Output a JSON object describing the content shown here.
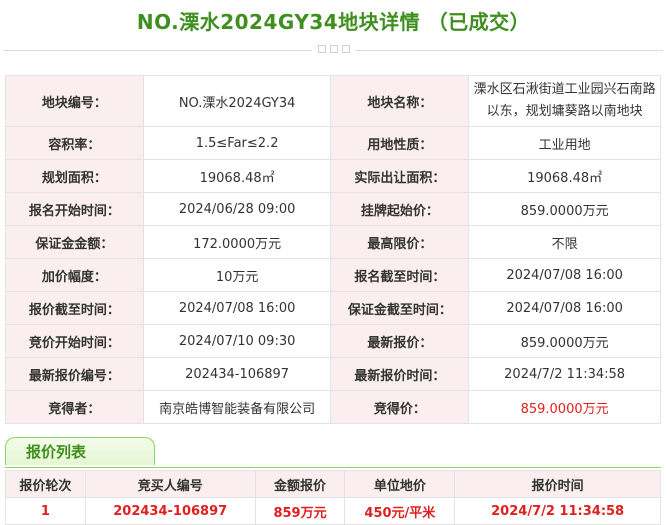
{
  "page": {
    "title": "NO.溧水2024GY34地块详情 （已成交）"
  },
  "info_rows": [
    [
      {
        "label": "地块编号：",
        "value": "NO.溧水2024GY34"
      },
      {
        "label": "地块名称：",
        "value": "溧水区石湫街道工业园兴石南路以东，规划墉葵路以南地块"
      }
    ],
    [
      {
        "label": "容积率：",
        "value": "1.5≤Far≤2.2"
      },
      {
        "label": "用地性质：",
        "value": "工业用地"
      }
    ],
    [
      {
        "label": "规划面积：",
        "value": "19068.48㎡"
      },
      {
        "label": "实际出让面积：",
        "value": "19068.48㎡"
      }
    ],
    [
      {
        "label": "报名开始时间：",
        "value": "2024/06/28 09:00"
      },
      {
        "label": "挂牌起始价：",
        "value": "859.0000万元"
      }
    ],
    [
      {
        "label": "保证金金额：",
        "value": "172.0000万元"
      },
      {
        "label": "最高限价：",
        "value": "不限"
      }
    ],
    [
      {
        "label": "加价幅度：",
        "value": "10万元"
      },
      {
        "label": "报名截至时间：",
        "value": "2024/07/08 16:00"
      }
    ],
    [
      {
        "label": "报价截至时间：",
        "value": "2024/07/08 16:00"
      },
      {
        "label": "保证金截至时间：",
        "value": "2024/07/08 16:00"
      }
    ],
    [
      {
        "label": "竞价开始时间：",
        "value": "2024/07/10 09:30"
      },
      {
        "label": "最新报价：",
        "value": "859.0000万元"
      }
    ],
    [
      {
        "label": "最新报价编号：",
        "value": "202434-106897"
      },
      {
        "label": "最新报价时间：",
        "value": "2024/7/2 11:34:58"
      }
    ],
    [
      {
        "label": "竞得者：",
        "value": "南京皓博智能装备有限公司"
      },
      {
        "label": "竞得价：",
        "value": "859.0000万元"
      }
    ]
  ],
  "bid_tab": {
    "label": "报价列表"
  },
  "bid_table": {
    "headers": [
      "报价轮次",
      "竞买人编号",
      "金额报价",
      "单位地价",
      "报价时间"
    ],
    "rows": [
      [
        "1",
        "202434-106897",
        "859万元",
        "450元/平米",
        "2024/7/2 11:34:58"
      ]
    ]
  },
  "colors": {
    "title_green": "#3f8f1f",
    "label_bg": "#fbeeee",
    "highlight_red": "#e02020"
  }
}
